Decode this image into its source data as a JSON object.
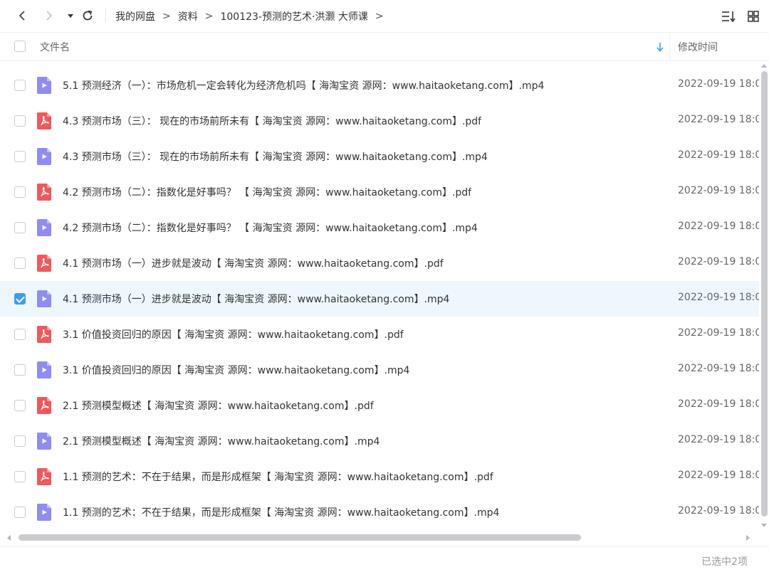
{
  "breadcrumb": {
    "items": [
      "我的网盘",
      "资料",
      "100123-预测的艺术·洪灏 大师课"
    ],
    "separator": ">"
  },
  "header": {
    "name_label": "文件名",
    "time_label": "修改时间"
  },
  "colors": {
    "video_icon": "#8f8cf4",
    "pdf_icon": "#f0585a",
    "check_accent": "#3d9bf7",
    "selected_row_bg": "#eef7fe"
  },
  "files": [
    {
      "name": "5.1 预测经济（一）：市场危机一定会转化为经济危机吗【 海淘宝资 源网：www.haitaoketang.com】.mp4",
      "time": "2022-09-19 18:0",
      "type": "video",
      "icon": "video-file-icon",
      "checked": false
    },
    {
      "name": "4.3 预测市场（三）： 现在的市场前所未有【 海淘宝资 源网：www.haitaoketang.com】.pdf",
      "time": "2022-09-19 18:0",
      "type": "pdf",
      "icon": "pdf-file-icon",
      "checked": false
    },
    {
      "name": "4.3 预测市场（三）： 现在的市场前所未有【 海淘宝资 源网：www.haitaoketang.com】.mp4",
      "time": "2022-09-19 18:0",
      "type": "video",
      "icon": "video-file-icon",
      "checked": false
    },
    {
      "name": "4.2 预测市场（二）：指数化是好事吗？ 【 海淘宝资 源网：www.haitaoketang.com】.pdf",
      "time": "2022-09-19 18:0",
      "type": "pdf",
      "icon": "pdf-file-icon",
      "checked": false
    },
    {
      "name": "4.2 预测市场（二）：指数化是好事吗？ 【 海淘宝资 源网：www.haitaoketang.com】.mp4",
      "time": "2022-09-19 18:0",
      "type": "video",
      "icon": "video-file-icon",
      "checked": false
    },
    {
      "name": "4.1 预测市场（一）进步就是波动【 海淘宝资 源网：www.haitaoketang.com】.pdf",
      "time": "2022-09-19 18:0",
      "type": "pdf",
      "icon": "pdf-file-icon",
      "checked": false
    },
    {
      "name": "4.1 预测市场（一）进步就是波动【 海淘宝资 源网：www.haitaoketang.com】.mp4",
      "time": "2022-09-19 18:0",
      "type": "video",
      "icon": "video-file-icon",
      "checked": true
    },
    {
      "name": "3.1 价值投资回归的原因【 海淘宝资 源网：www.haitaoketang.com】.pdf",
      "time": "2022-09-19 18:0",
      "type": "pdf",
      "icon": "pdf-file-icon",
      "checked": false
    },
    {
      "name": "3.1 价值投资回归的原因【 海淘宝资 源网：www.haitaoketang.com】.mp4",
      "time": "2022-09-19 18:0",
      "type": "video",
      "icon": "video-file-icon",
      "checked": false
    },
    {
      "name": "2.1 预测模型概述【 海淘宝资 源网：www.haitaoketang.com】.pdf",
      "time": "2022-09-19 18:0",
      "type": "pdf",
      "icon": "pdf-file-icon",
      "checked": false
    },
    {
      "name": "2.1 预测模型概述【 海淘宝资 源网：www.haitaoketang.com】.mp4",
      "time": "2022-09-19 18:0",
      "type": "video",
      "icon": "video-file-icon",
      "checked": false
    },
    {
      "name": "1.1 预测的艺术：不在于结果，而是形成框架【 海淘宝资 源网：www.haitaoketang.com】.pdf",
      "time": "2022-09-19 18:0",
      "type": "pdf",
      "icon": "pdf-file-icon",
      "checked": false
    },
    {
      "name": "1.1 预测的艺术：不在于结果，而是形成框架【 海淘宝资 源网：www.haitaoketang.com】.mp4",
      "time": "2022-09-19 18:0",
      "type": "video",
      "icon": "video-file-icon",
      "checked": false
    }
  ],
  "status": {
    "selection_text": "已选中2项"
  }
}
